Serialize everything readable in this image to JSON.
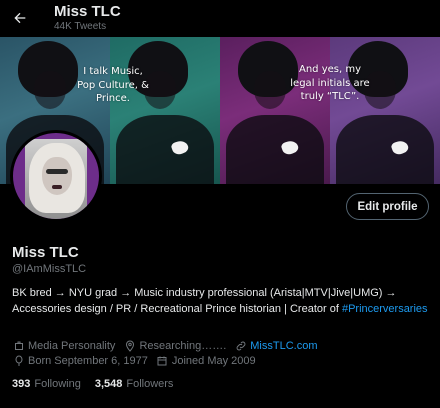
{
  "header": {
    "title": "Miss TLC",
    "tweet_count": "44K Tweets"
  },
  "banner": {
    "caption_left": "I talk Music, Pop Culture, & Prince.",
    "caption_right": "And yes, my legal initials are truly “TLC”."
  },
  "profile": {
    "edit_label": "Edit profile",
    "name": "Miss TLC",
    "handle": "@IAmMissTLC",
    "bio_text": "BK bred → NYU grad → Music industry professional (Arista|MTV|Jive|UMG) → Accessories design / PR / Recreational Prince historian | Creator of ",
    "bio_hashtag": "#Princerversaries",
    "category": "Media Personality",
    "location": "Researching…….",
    "website": "MissTLC.com",
    "born": "Born September 6, 1977",
    "joined": "Joined May 2009",
    "following_count": "393",
    "following_label": "Following",
    "followers_count": "3,548",
    "followers_label": "Followers"
  },
  "colors": {
    "background": "#000000",
    "text": "#e7e9ea",
    "muted": "#71767b",
    "accent": "#1d9bf0"
  },
  "icons": [
    "back-arrow-icon",
    "briefcase-icon",
    "location-pin-icon",
    "link-icon",
    "balloon-icon",
    "calendar-icon"
  ]
}
